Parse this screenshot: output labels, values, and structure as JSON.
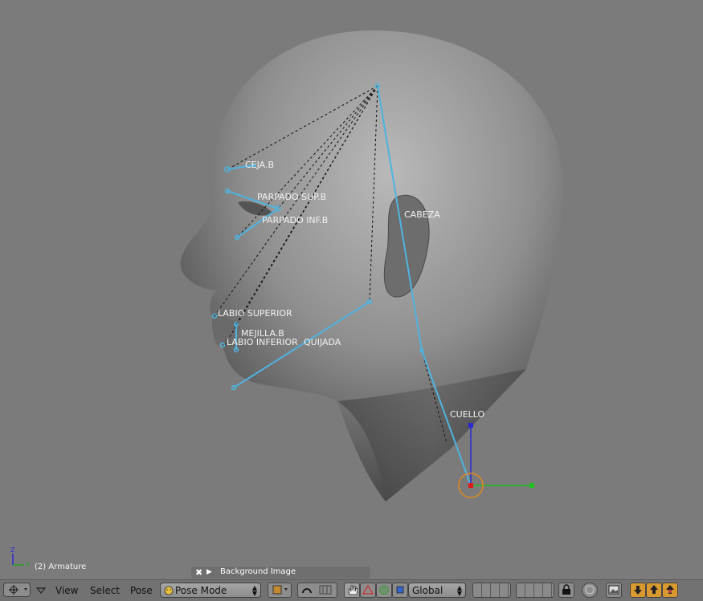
{
  "viewport": {
    "armature_label": "(2) Armature",
    "bones": [
      {
        "name": "CEJA.B"
      },
      {
        "name": "PARPADO SUP.B"
      },
      {
        "name": "PARPADO INF.B"
      },
      {
        "name": "CABEZA"
      },
      {
        "name": "LABIO SUPERIOR"
      },
      {
        "name": "MEJILLA.B"
      },
      {
        "name": "LABIO INFERIOR"
      },
      {
        "name": "QUIJADA"
      },
      {
        "name": "CUELLO"
      }
    ],
    "axis": {
      "x": "Y",
      "y": "Z"
    },
    "colors": {
      "bone": "#4fb3e0",
      "background": "#7b7b7b",
      "pivot": "#e08a20"
    }
  },
  "background_panel": {
    "label": "Background Image",
    "close_icon": "✖",
    "expand_icon": "▶"
  },
  "header": {
    "menus": [
      "View",
      "Select",
      "Pose"
    ],
    "mode": "Pose Mode",
    "orientation": "Global"
  }
}
